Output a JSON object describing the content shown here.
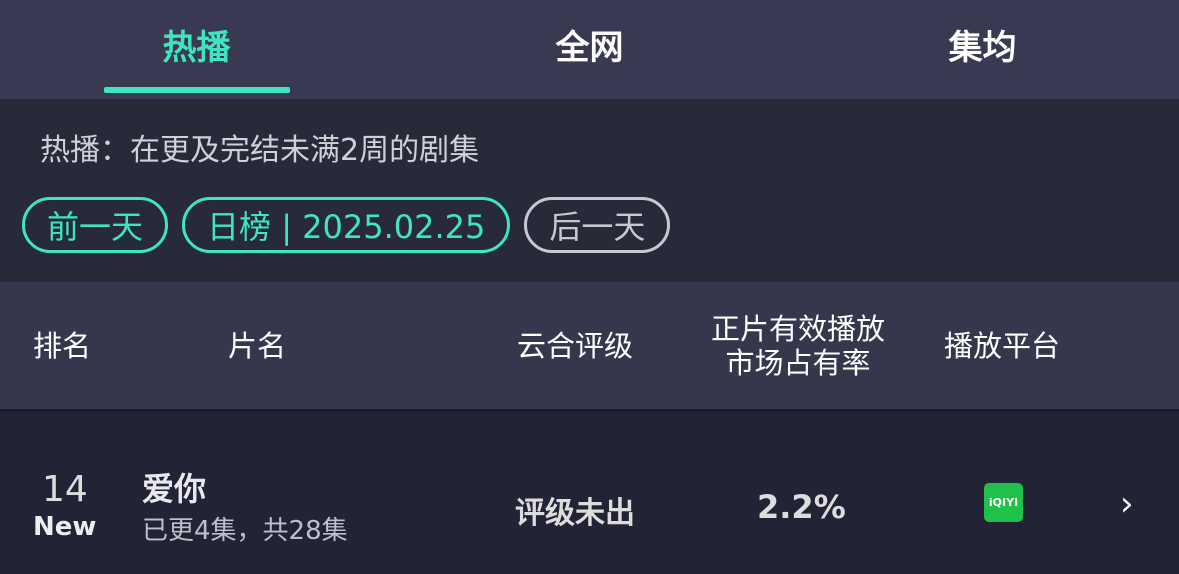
{
  "tabs": [
    {
      "label": "热播"
    },
    {
      "label": "全网"
    },
    {
      "label": "集均"
    }
  ],
  "description": "热播：在更及完结未满2周的剧集",
  "date_nav": {
    "prev": "前一天",
    "current": "日榜 | 2025.02.25",
    "next": "后一天"
  },
  "columns": {
    "rank": "排名",
    "title": "片名",
    "rating": "云合评级",
    "share_line1": "正片有效播放",
    "share_line2": "市场占有率",
    "platform": "播放平台"
  },
  "rows": [
    {
      "rank": "14",
      "badge": "New",
      "title": "爱你",
      "episodes": "已更4集，共28集",
      "rating": "评级未出",
      "share": "2.2%",
      "platform_logo": "iQIYI",
      "platform_icon": "iqiyi-logo",
      "platform_color": "#1fc14a"
    }
  ],
  "accent_color": "#3ee6c0"
}
